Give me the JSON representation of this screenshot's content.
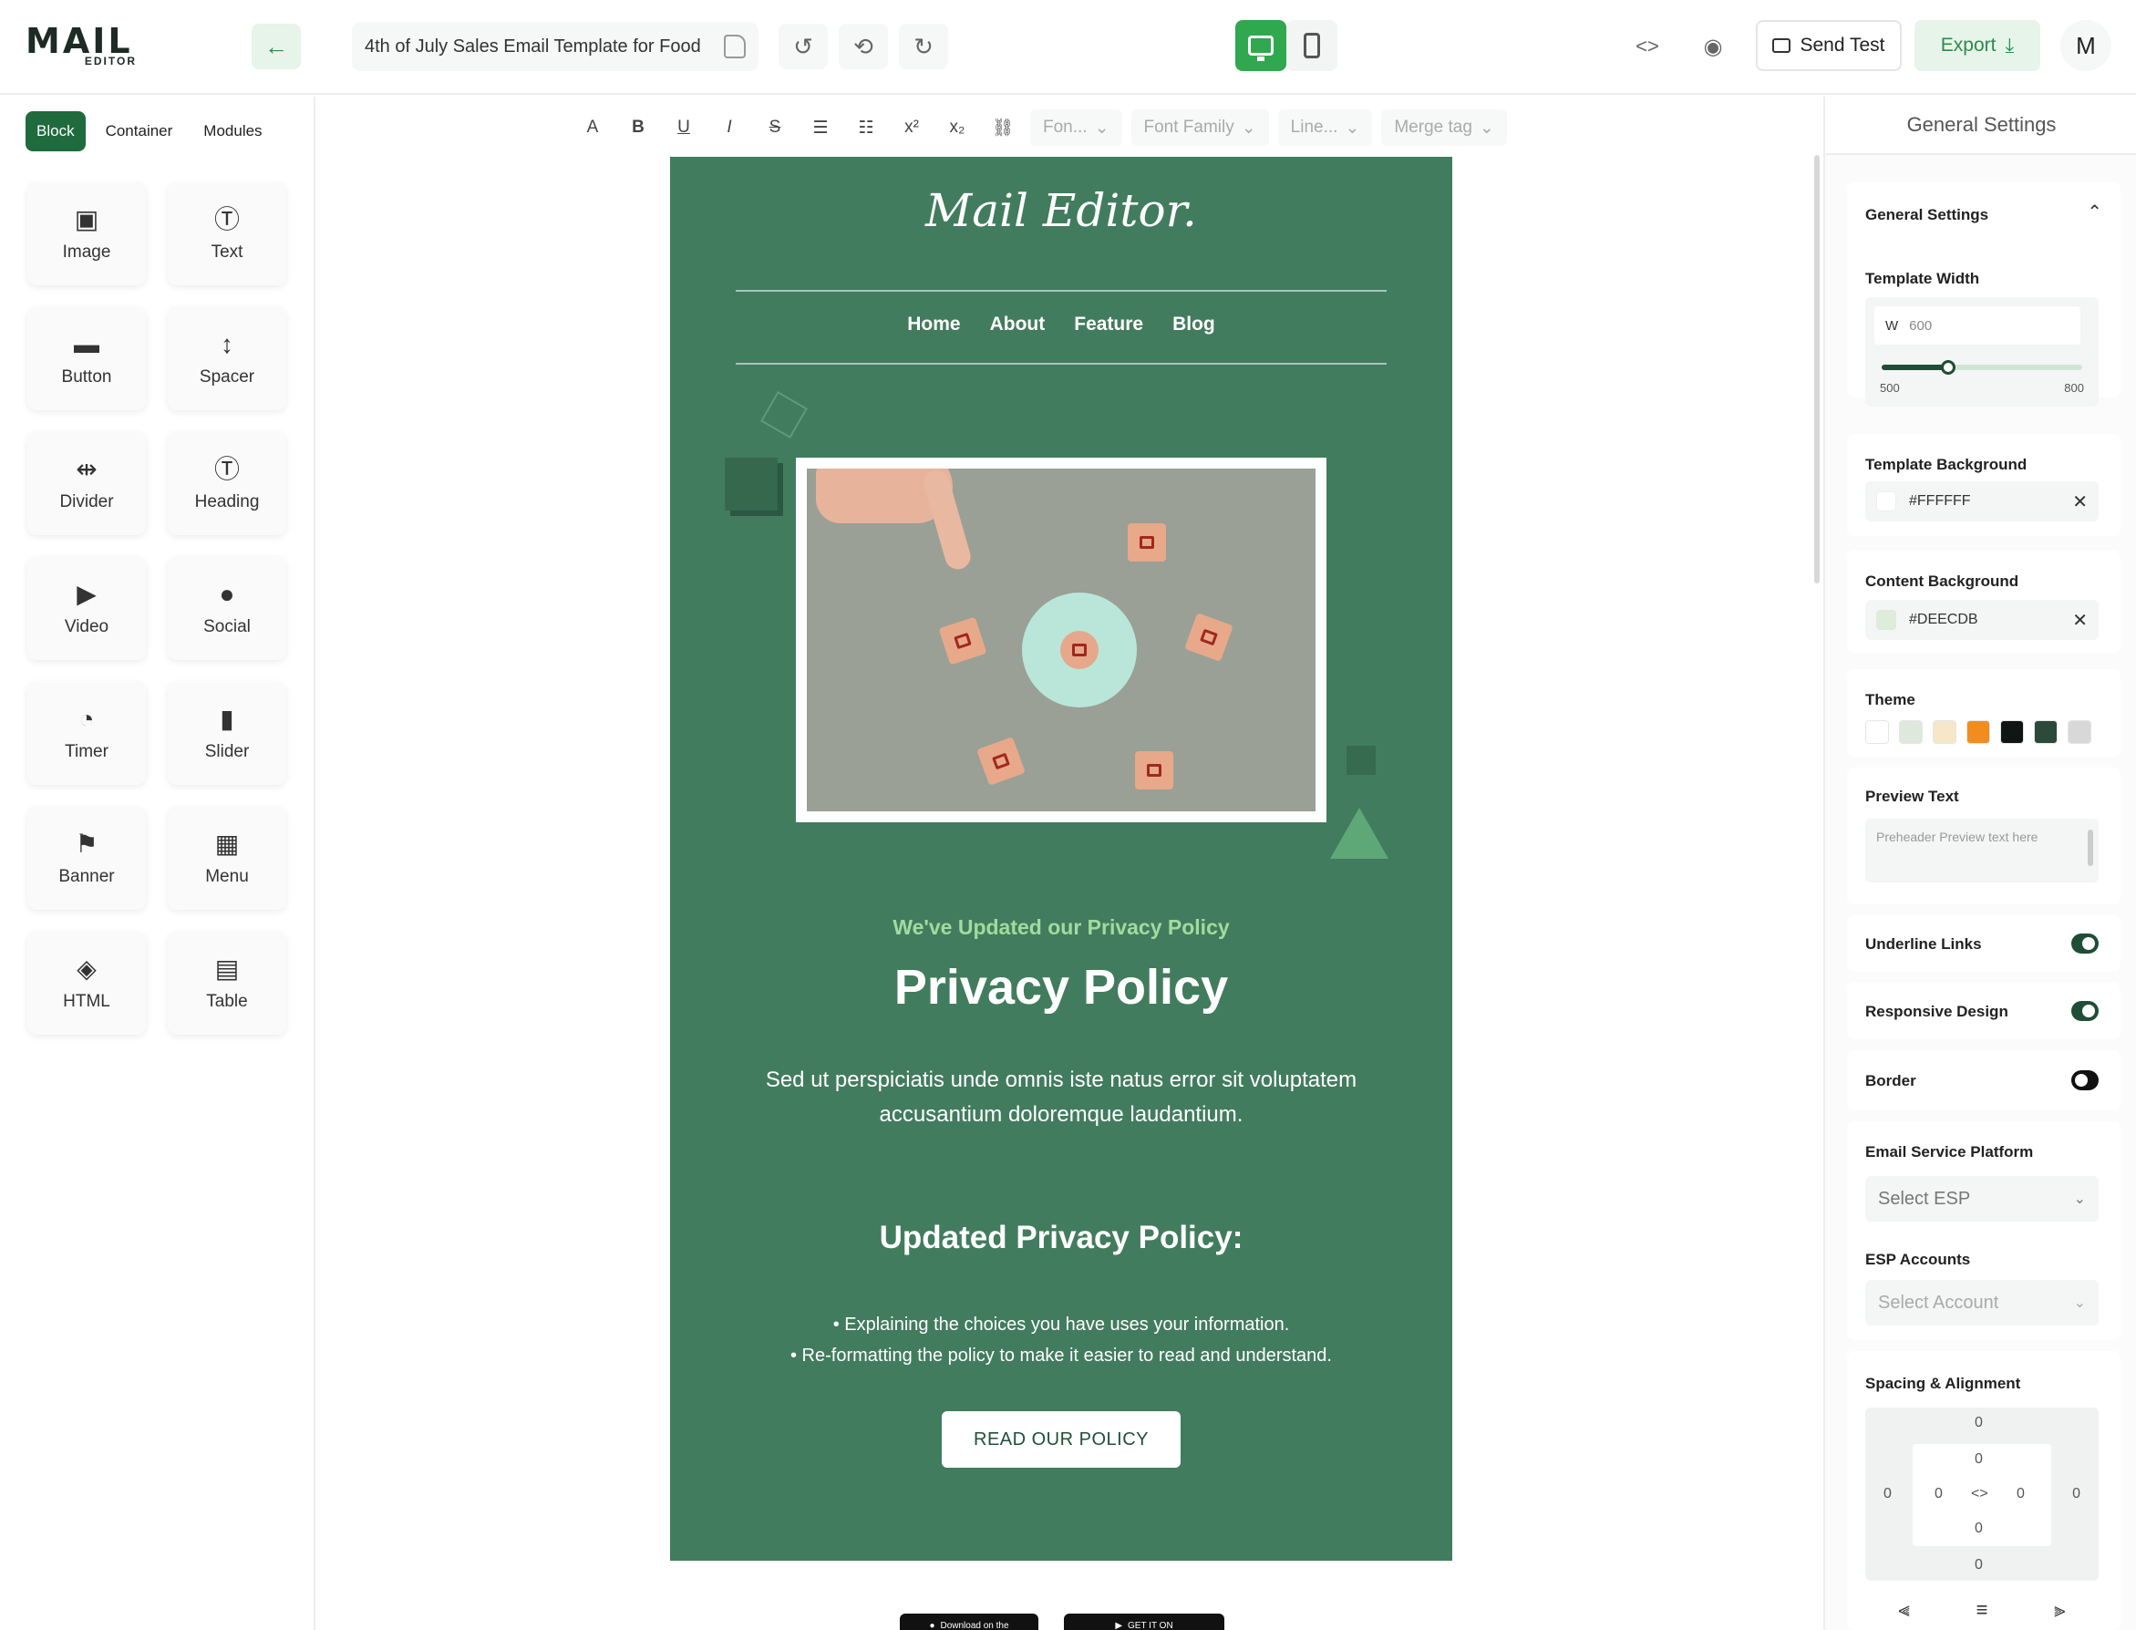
{
  "app": {
    "logo_word": "MAIL",
    "logo_sub": "EDITOR",
    "template_title": "4th of July Sales Email Template for Food",
    "send_test_label": "Send Test",
    "export_label": "Export",
    "avatar_initial": "M"
  },
  "left_sidebar": {
    "tabs": [
      {
        "label": "Block",
        "active": true
      },
      {
        "label": "Container",
        "active": false
      },
      {
        "label": "Modules",
        "active": false
      }
    ],
    "blocks": [
      {
        "label": "Image",
        "icon": "image-icon"
      },
      {
        "label": "Text",
        "icon": "text-icon"
      },
      {
        "label": "Button",
        "icon": "button-icon"
      },
      {
        "label": "Spacer",
        "icon": "spacer-icon"
      },
      {
        "label": "Divider",
        "icon": "divider-icon"
      },
      {
        "label": "Heading",
        "icon": "heading-icon"
      },
      {
        "label": "Video",
        "icon": "video-icon"
      },
      {
        "label": "Social",
        "icon": "social-icon"
      },
      {
        "label": "Timer",
        "icon": "timer-icon"
      },
      {
        "label": "Slider",
        "icon": "slider-icon"
      },
      {
        "label": "Banner",
        "icon": "banner-icon"
      },
      {
        "label": "Menu",
        "icon": "menu-icon"
      },
      {
        "label": "HTML",
        "icon": "html-icon"
      },
      {
        "label": "Table",
        "icon": "table-icon"
      }
    ]
  },
  "toolbar": {
    "font_size_placeholder": "Fon...",
    "font_family_placeholder": "Font Family",
    "line_height_placeholder": "Line...",
    "merge_tag_placeholder": "Merge tag"
  },
  "email": {
    "logo_text": "Mail Editor.",
    "nav": [
      "Home",
      "About",
      "Feature",
      "Blog"
    ],
    "subheading": "We've Updated our Privacy Policy",
    "headline": "Privacy Policy",
    "body": "Sed ut perspiciatis unde omnis iste natus error sit voluptatem accusantium doloremque laudantium.",
    "section_title": "Updated Privacy Policy:",
    "bullets": [
      "• Explaining the choices you have uses your information.",
      "• Re-formatting the policy to make it easier to read and understand."
    ],
    "cta_label": "READ OUR POLICY",
    "app_store_label": "Download on the",
    "play_store_label": "GET IT ON"
  },
  "right_panel": {
    "header": "General Settings",
    "general_settings_title": "General Settings",
    "template_width_label": "Template Width",
    "width_prefix": "W",
    "width_value": "600",
    "width_min": "500",
    "width_max": "800",
    "width_slider_value": 600,
    "template_background_label": "Template Background",
    "template_background_value": "#FFFFFF",
    "content_background_label": "Content Background",
    "content_background_value": "#DEECDB",
    "theme_label": "Theme",
    "theme_colors": [
      "#ffffff",
      "#dfe8dd",
      "#f6e7c8",
      "#f28c1c",
      "#101613",
      "#2c4a3a",
      "#d8d8d8"
    ],
    "preview_text_label": "Preview Text",
    "preview_text_placeholder": "Preheader Preview text here",
    "underline_links_label": "Underline Links",
    "underline_links_on": true,
    "responsive_design_label": "Responsive Design",
    "responsive_design_on": true,
    "border_label": "Border",
    "border_on": false,
    "esp_label": "Email Service Platform",
    "esp_placeholder": "Select ESP",
    "esp_accounts_label": "ESP Accounts",
    "esp_accounts_placeholder": "Select Account",
    "spacing_label": "Spacing & Alignment",
    "spacing_values": [
      "0",
      "0",
      "0",
      "0",
      "0",
      "0",
      "0",
      "0",
      "0",
      "0"
    ]
  },
  "colors": {
    "brand_green": "#2fa84f",
    "email_bg": "#427c5e",
    "tab_active": "#1f6b3e"
  }
}
